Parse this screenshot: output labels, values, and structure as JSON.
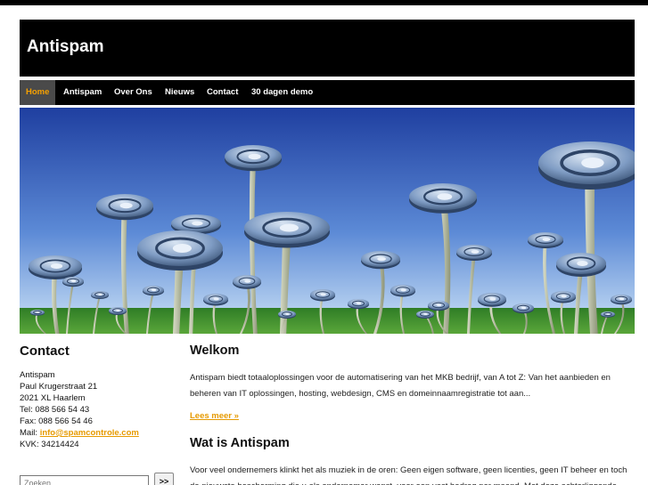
{
  "site": {
    "title": "Antispam"
  },
  "nav": {
    "items": [
      {
        "label": "Home",
        "active": true
      },
      {
        "label": "Antispam",
        "active": false
      },
      {
        "label": "Over Ons",
        "active": false
      },
      {
        "label": "Nieuws",
        "active": false
      },
      {
        "label": "Contact",
        "active": false
      },
      {
        "label": "30 dagen demo",
        "active": false
      }
    ]
  },
  "sidebar": {
    "title": "Contact",
    "company": "Antispam",
    "street": "Paul Krugerstraat 21",
    "city": "2021 XL Haarlem",
    "tel": "Tel: 088 566 54 43",
    "fax": "Fax: 088 566 54 46",
    "mail_prefix": "Mail: ",
    "mail_link": "info@spamcontrole.com",
    "kvk": "KVK: 34214424"
  },
  "search": {
    "placeholder": "Zoeken",
    "button_label": ">>"
  },
  "main": {
    "welcome_title": "Welkom",
    "welcome_text": "Antispam biedt totaaloplossingen voor de automatisering van het MKB bedrijf, van A tot Z: Van het aanbieden en beheren van IT oplossingen, hosting, webdesign, CMS en domeinnaamregistratie tot aan...",
    "read_more": "Lees meer »",
    "section2_title": "Wat is Antispam",
    "section2_text": "Voor veel ondernemers klinkt het als muziek in de oren: Geen eigen software, geen licenties, geen IT beheer en toch de nieuwste bescherming die u als ondernemer wenst, voor een vast bedrag per maand. Met deze achterliggende"
  },
  "colors": {
    "accent": "#e69a00",
    "nav_bg": "#000000",
    "active_bg": "#4a4a4a",
    "sky_top": "#1f3fa0",
    "grass": "#3a8a2a"
  },
  "icons": {
    "banner_flower": "at-sign-flower-icon"
  }
}
